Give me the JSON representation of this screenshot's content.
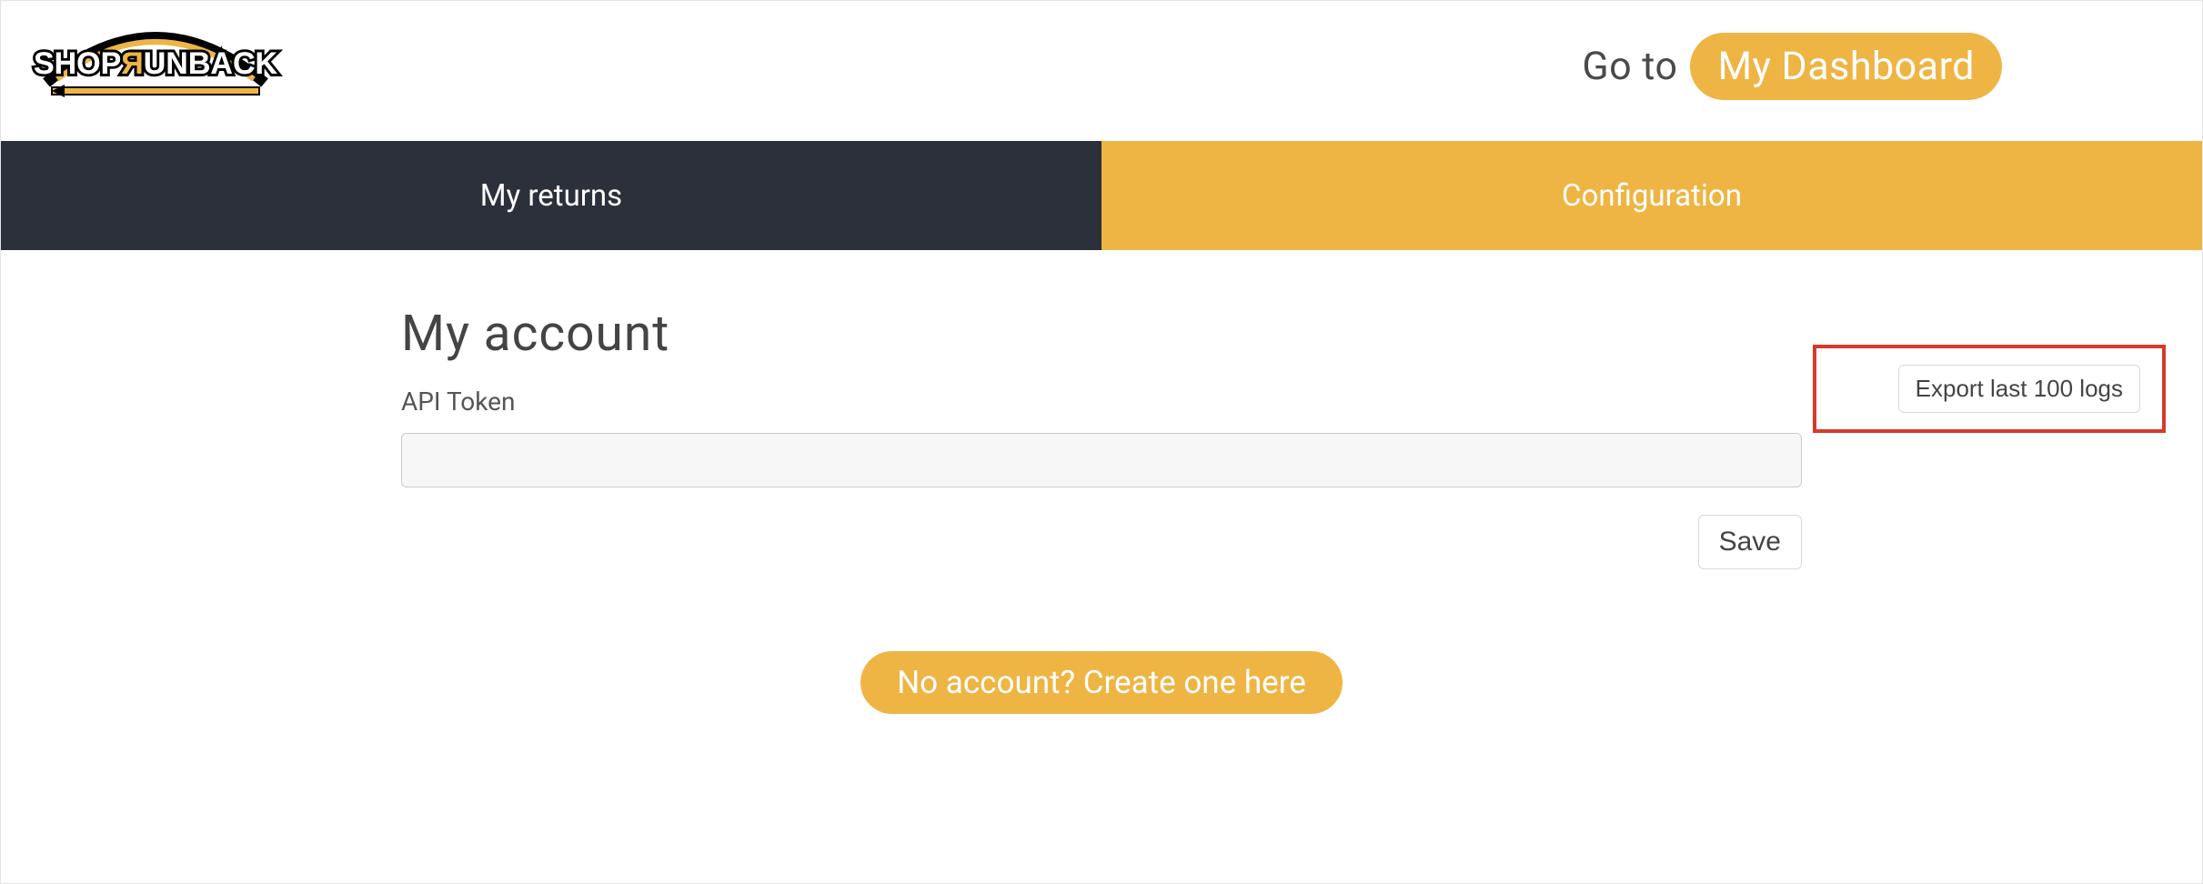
{
  "header": {
    "goto_prefix": "Go to",
    "dashboard_btn": "My Dashboard"
  },
  "tabs": {
    "returns": "My returns",
    "config": "Configuration"
  },
  "account": {
    "title": "My account",
    "token_label": "API Token",
    "token_value": "",
    "save_btn": "Save",
    "export_btn": "Export last 100 logs",
    "create_btn": "No account? Create one here"
  },
  "logo": {
    "alt": "ShopRunBack"
  }
}
